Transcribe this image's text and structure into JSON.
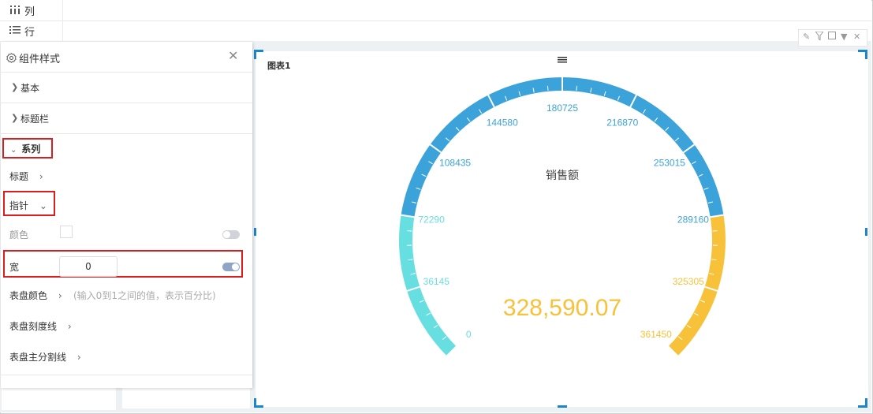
{
  "topbar": {
    "columns_label": "列",
    "rows_label": "行"
  },
  "panel": {
    "title": "组件样式",
    "sections": {
      "basic": "基本",
      "titlebar": "标题栏",
      "series": "系列"
    },
    "items": {
      "title": "标题",
      "pointer": "指针",
      "color": "颜色",
      "width": "宽",
      "width_value": "0",
      "dial_color": "表盘颜色",
      "width_hint": "(输入0到1之间的值，表示百分比)",
      "dial_tick": "表盘刻度线",
      "dial_split": "表盘主分割线"
    },
    "toggles": {
      "color_enabled": false,
      "width_enabled": true
    }
  },
  "chart_data": {
    "type": "gauge",
    "title": "图表1",
    "series_name": "销售额",
    "value": 328590.07,
    "value_label": "328,590.07",
    "min": 0,
    "max": 361450,
    "tick_labels": [
      "0",
      "36145",
      "72290",
      "108435",
      "144580",
      "180725",
      "216870",
      "253015",
      "289160",
      "325305",
      "361450"
    ],
    "color_bands": [
      {
        "to_fraction": 0.2,
        "color": "#67dfe0"
      },
      {
        "to_fraction": 0.8,
        "color": "#3ca3da"
      },
      {
        "to_fraction": 1.0,
        "color": "#f8c13a"
      }
    ]
  },
  "colors": {
    "accent": "#1b87c9",
    "highlight": "#d71f1f",
    "value_color": "#f8c13a"
  }
}
